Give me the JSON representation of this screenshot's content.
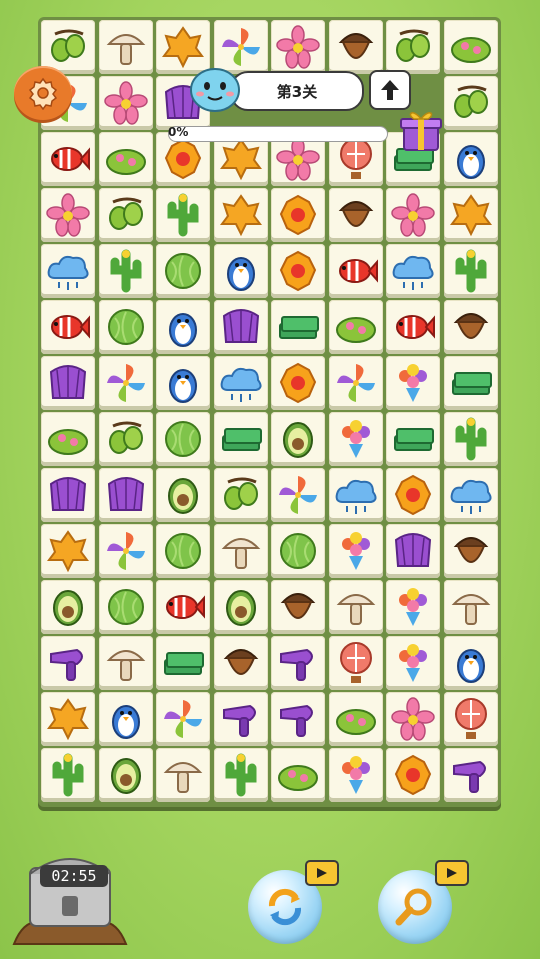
{
  "level": {
    "label": "第3关"
  },
  "progress": {
    "label": "0%",
    "value_percent": 0
  },
  "timer": {
    "value": "02:55"
  },
  "board": {
    "columns": 8,
    "rows": 14,
    "tiles": [
      [
        "olive",
        "mushroom",
        "leaf",
        "pinwheel",
        "flower",
        "acorn",
        "olive",
        "slipper"
      ],
      [
        "pinwheel",
        "flower",
        "fan",
        "",
        "",
        "",
        "",
        "olive"
      ],
      [
        "fish",
        "slipper",
        "poppy",
        "leaf",
        "flower",
        "balloon",
        "cash",
        "penguin"
      ],
      [
        "flower",
        "olive",
        "cactus",
        "leaf",
        "poppy",
        "acorn",
        "flower",
        "leaf"
      ],
      [
        "cloud",
        "cactus",
        "cabbage",
        "penguin",
        "poppy",
        "fish",
        "cloud",
        "cactus"
      ],
      [
        "fish",
        "cabbage",
        "penguin",
        "fan",
        "cash",
        "slipper",
        "fish",
        "acorn"
      ],
      [
        "fan",
        "pinwheel",
        "penguin",
        "cloud",
        "poppy",
        "pinwheel",
        "bouquet",
        "cash"
      ],
      [
        "slipper",
        "olive",
        "cabbage",
        "cash",
        "avocado",
        "bouquet",
        "cash",
        "cactus"
      ],
      [
        "fan",
        "fan",
        "avocado",
        "olive",
        "pinwheel",
        "cloud",
        "poppy",
        "cloud"
      ],
      [
        "leaf",
        "pinwheel",
        "cabbage",
        "mushroom",
        "cabbage",
        "bouquet",
        "fan",
        "acorn"
      ],
      [
        "avocado",
        "cabbage",
        "fish",
        "avocado",
        "acorn",
        "mushroom",
        "bouquet",
        "mushroom"
      ],
      [
        "hairdryer",
        "mushroom",
        "cash",
        "acorn",
        "hairdryer",
        "balloon",
        "bouquet",
        "penguin"
      ],
      [
        "leaf",
        "penguin",
        "pinwheel",
        "hairdryer",
        "hairdryer",
        "slipper",
        "flower",
        "balloon"
      ],
      [
        "cactus",
        "avocado",
        "mushroom",
        "cactus",
        "slipper",
        "bouquet",
        "poppy",
        "hairdryer"
      ]
    ]
  },
  "icons": {
    "settings": "gear-icon",
    "level_up": "arrow-up-icon",
    "gift": "gift-icon",
    "shuffle": "shuffle-icon",
    "hint": "magnifier-icon",
    "video": "video-ad-icon",
    "chest": "treasure-chest-icon",
    "mascot": "mascot-face-icon"
  },
  "colors": {
    "background": "#a3d45e",
    "board": "#6f8f44",
    "tile": "#fbf8e6",
    "settings": "#e87a2a",
    "video_badge": "#f7c531"
  }
}
